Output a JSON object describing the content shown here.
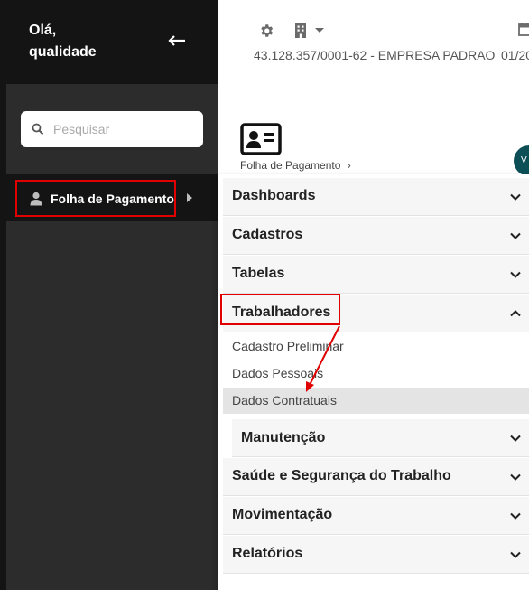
{
  "sidebar": {
    "greeting_line1": "Olá,",
    "greeting_line2": "qualidade",
    "search_placeholder": "Pesquisar",
    "menu_item": "Folha de Pagamento"
  },
  "header": {
    "company": "43.128.357/0001-62 - EMPRESA PADRAO",
    "date_fragment": "01/20"
  },
  "content": {
    "breadcrumb": "Folha de Pagamento",
    "avatar_letter": "V"
  },
  "panel": {
    "sections": [
      {
        "label": "Dashboards",
        "expanded": false
      },
      {
        "label": "Cadastros",
        "expanded": false
      },
      {
        "label": "Tabelas",
        "expanded": false
      },
      {
        "label": "Trabalhadores",
        "expanded": true
      },
      {
        "label": "Saúde e Segurança do Trabalho",
        "expanded": false
      },
      {
        "label": "Movimentação",
        "expanded": false
      },
      {
        "label": "Relatórios",
        "expanded": false
      }
    ],
    "sub_items": [
      "Cadastro Preliminar",
      "Dados Pessoais",
      "Dados Contratuais"
    ],
    "sub_section": "Manutenção"
  },
  "colors": {
    "highlight_border": "#e00000",
    "sidebar_dark": "#141414",
    "sidebar_body": "#2c2c2c"
  }
}
